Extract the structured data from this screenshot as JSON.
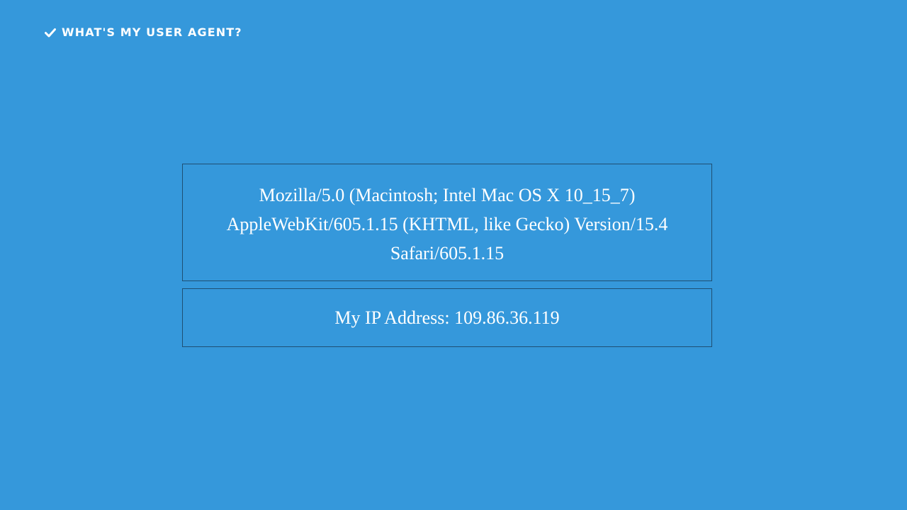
{
  "header": {
    "icon": "check-icon",
    "title": "What's my User Agent?"
  },
  "user_agent": {
    "lines": [
      "Mozilla/5.0 (Macintosh; Intel Mac OS X 10_15_7)",
      "AppleWebKit/605.1.15 (KHTML, like Gecko) Version/15.4",
      "Safari/605.1.15"
    ]
  },
  "ip": {
    "label": "My IP Address:",
    "value": "109.86.36.119"
  },
  "colors": {
    "background": "#3598db",
    "text": "#ffffff",
    "box_border": "#1f4f73"
  }
}
